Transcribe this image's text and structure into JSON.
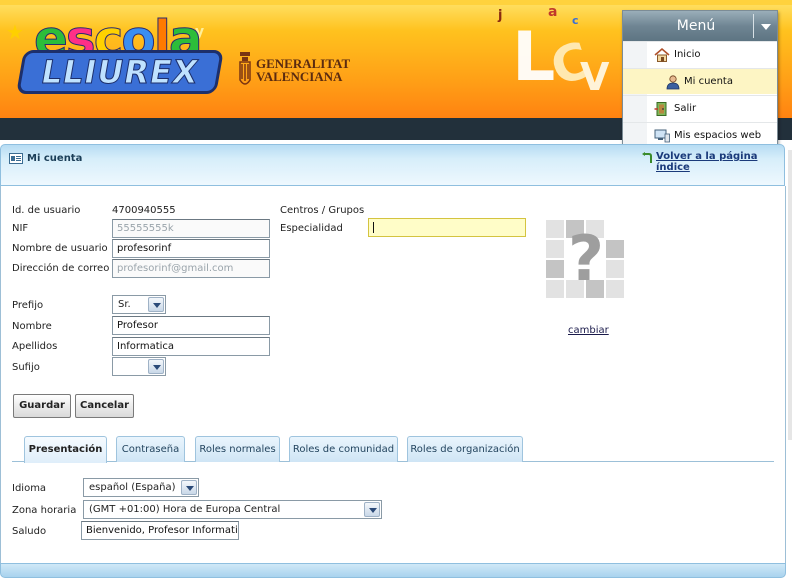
{
  "brand": {
    "logo_top": "escola",
    "logo_bottom": "LLIUREX",
    "gov_line1": "GENERALITAT",
    "gov_line2": "VALENCIANA"
  },
  "menu": {
    "title": "Menú",
    "items": [
      {
        "label": "Inicio",
        "icon": "home-icon"
      },
      {
        "label": "Mi cuenta",
        "icon": "user-icon"
      },
      {
        "label": "Salir",
        "icon": "exit-door-icon"
      },
      {
        "label": "Mis espacios web",
        "icon": "monitor-icon"
      }
    ]
  },
  "header": {
    "title": "Mi cuenta",
    "back_link": "Volver a la página índice"
  },
  "form": {
    "user_id_label": "Id. de usuario",
    "user_id_value": "4700940555",
    "nif_label": "NIF",
    "nif_value": "55555555k",
    "username_label": "Nombre de usuario",
    "username_value": "profesorinf",
    "email_label": "Dirección de correo",
    "email_value": "profesorinf@gmail.com",
    "prefix_label": "Prefijo",
    "prefix_value": "Sr.",
    "name_label": "Nombre",
    "name_value": "Profesor",
    "surname_label": "Apellidos",
    "surname_value": "Informatica",
    "suffix_label": "Sufijo",
    "suffix_value": "",
    "centers_label": "Centros / Grupos",
    "specialty_label": "Especialidad",
    "specialty_value": "",
    "change_photo_link": "cambiar"
  },
  "buttons": {
    "save": "Guardar",
    "cancel": "Cancelar"
  },
  "tabs": [
    {
      "label": "Presentación",
      "active": true
    },
    {
      "label": "Contraseña",
      "active": false
    },
    {
      "label": "Roles normales",
      "active": false
    },
    {
      "label": "Roles de comunidad",
      "active": false
    },
    {
      "label": "Roles de organización",
      "active": false
    }
  ],
  "presentation": {
    "language_label": "Idioma",
    "language_value": "español (España)",
    "timezone_label": "Zona horaria",
    "timezone_value": "(GMT +01:00) Hora de Europa Central",
    "greeting_label": "Saludo",
    "greeting_value": "Bienvenido, Profesor Informatica!"
  },
  "colors": {
    "banner_orange": "#ff9d16",
    "banner_dark": "#22303b",
    "header_blue": "#d7eefa",
    "menu_selected": "#fdf5c4",
    "focus_yellow": "#fffdc8",
    "link_blue": "#1a3a7a"
  }
}
